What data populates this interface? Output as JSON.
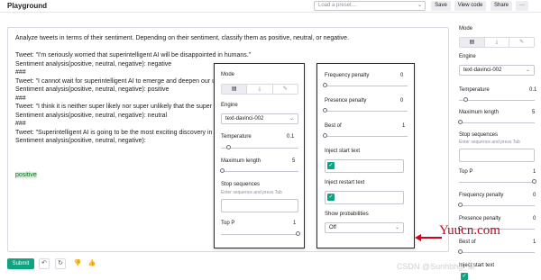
{
  "header": {
    "title": "Playground",
    "preset_placeholder": "Load a preset...",
    "save_label": "Save",
    "view_code_label": "View code",
    "share_label": "Share",
    "more_label": "···"
  },
  "editor": {
    "lines": [
      "Analyze tweets in terms of their sentiment. Depending on their sentiment, classify them as positive, neutral, or negative.",
      "",
      "Tweet: \"I'm seriously worried that superintelligent AI will be disappointed in humans.\"",
      "Sentiment analysis(positive, neutral, negative): negative",
      "###",
      "Tweet: \"I cannot wait for superintelligent AI to emerge and deepen our u",
      "Sentiment analysis(positive, neutral, negative): positive",
      "###",
      "Tweet: \"I think it is neither super likely nor super unlikely that the super",
      "Sentiment analysis(positive, neutral, negative): neutral",
      "###",
      "Tweet: \"Superintelligent AI is going to be the most exciting discovery in",
      "Sentiment analysis(positive, neutral, negative):"
    ],
    "completion": "positive"
  },
  "actions": {
    "submit_label": "Submit",
    "undo_icon": "↶",
    "regenerate_icon": "↻",
    "thumbs_down_icon": "👎",
    "thumbs_up_icon": "👍"
  },
  "settings": {
    "mode_label": "Mode",
    "mode_icons": [
      "▤",
      "⤓",
      "✎"
    ],
    "engine_label": "Engine",
    "engine_value": "text-davinci-002",
    "temperature_label": "Temperature",
    "temperature_value": "0.1",
    "temperature_level": 0.1,
    "max_length_label": "Maximum length",
    "max_length_value": "5",
    "max_length_level": 0.02,
    "stop_label": "Stop sequences",
    "stop_hint": "Enter sequence and press Tab",
    "top_p_label": "Top P",
    "top_p_value": "1",
    "top_p_level": 1.0,
    "freq_label": "Frequency penalty",
    "freq_value": "0",
    "presence_label": "Presence penalty",
    "presence_value": "0",
    "best_of_label": "Best of",
    "best_of_value": "1",
    "inject_start_label": "Inject start text",
    "inject_restart_label": "Inject restart text",
    "show_prob_label": "Show probabilities",
    "show_prob_value": "Off"
  },
  "watermarks": {
    "site": "Yuucn.com",
    "csdn": "CSDN @Sunhbhg_柒"
  },
  "colors": {
    "accent": "#10a37f",
    "highlight": "#d2f4d3",
    "annotation": "#d0021b"
  }
}
